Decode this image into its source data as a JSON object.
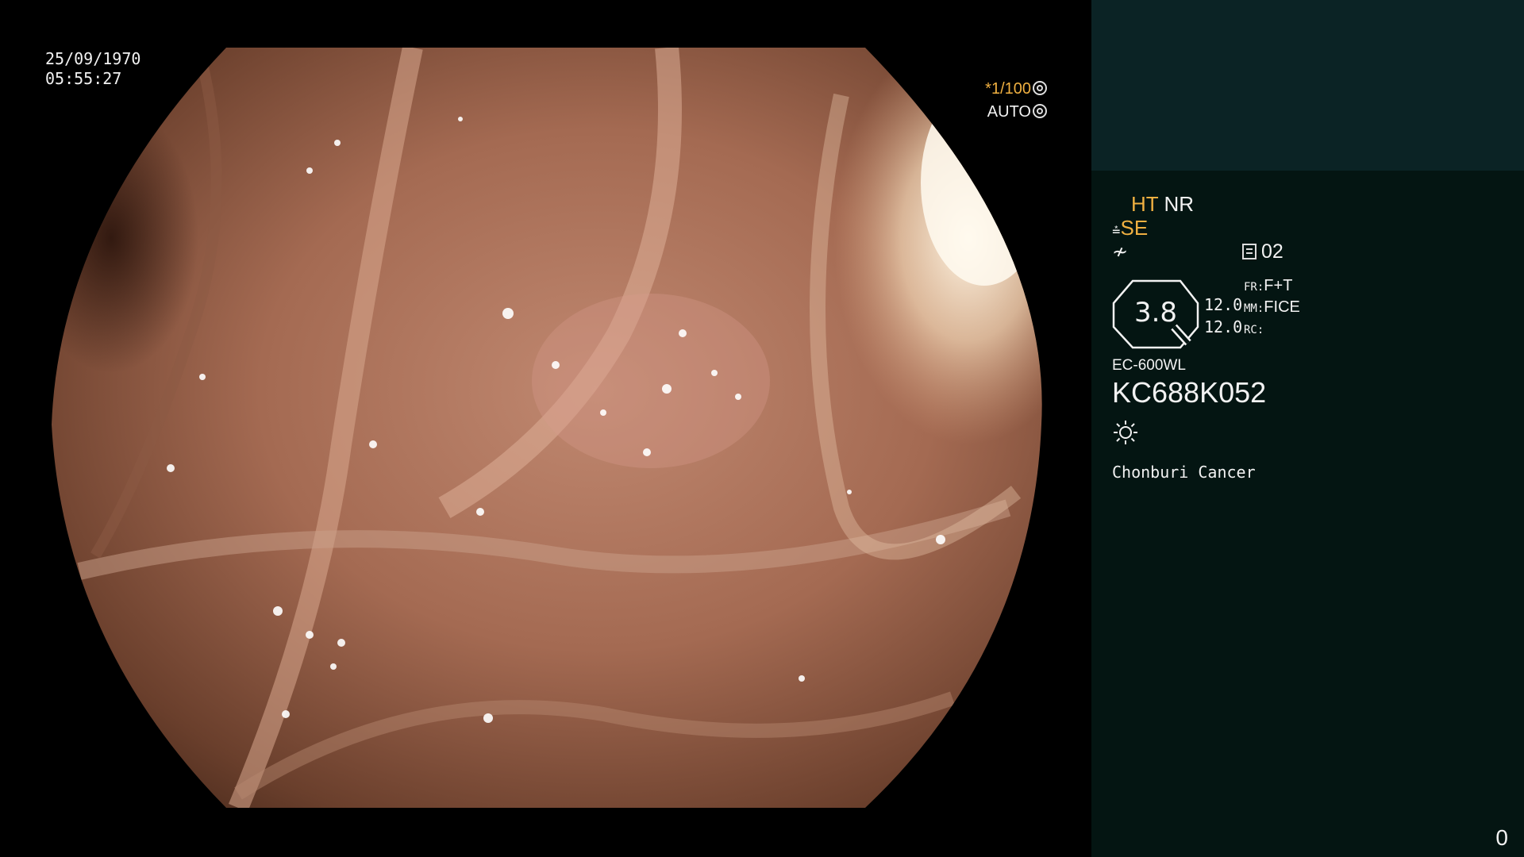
{
  "overlay": {
    "date": "25/09/1970",
    "time": "05:55:27",
    "shutter": "*1/100",
    "iris": "AUTO"
  },
  "panel": {
    "enhance_1": "HT",
    "enhance_2": "NR",
    "mode_se": "SE",
    "image_count": "02",
    "octagon_value": "3.8",
    "pressure_1": "12.0",
    "pressure_2": "12.0",
    "fr_label": "FR:",
    "fr_value": "F+T",
    "mm_label": "MM:",
    "mm_value": "FICE",
    "rc_label": "RC:",
    "scope_model": "EC-600WL",
    "scope_serial": "KC688K052",
    "institution": "Chonburi Cancer",
    "corner_index": "0"
  },
  "colors": {
    "accent_orange": "#f0b041",
    "panel_bg": "#041512",
    "panel_top_bg": "#0b2325"
  },
  "icons": [
    "shutter-ring-icon",
    "iris-ring-icon",
    "scope-angle-icon",
    "freeze-icon",
    "document-icon",
    "brightness-sun-icon"
  ]
}
